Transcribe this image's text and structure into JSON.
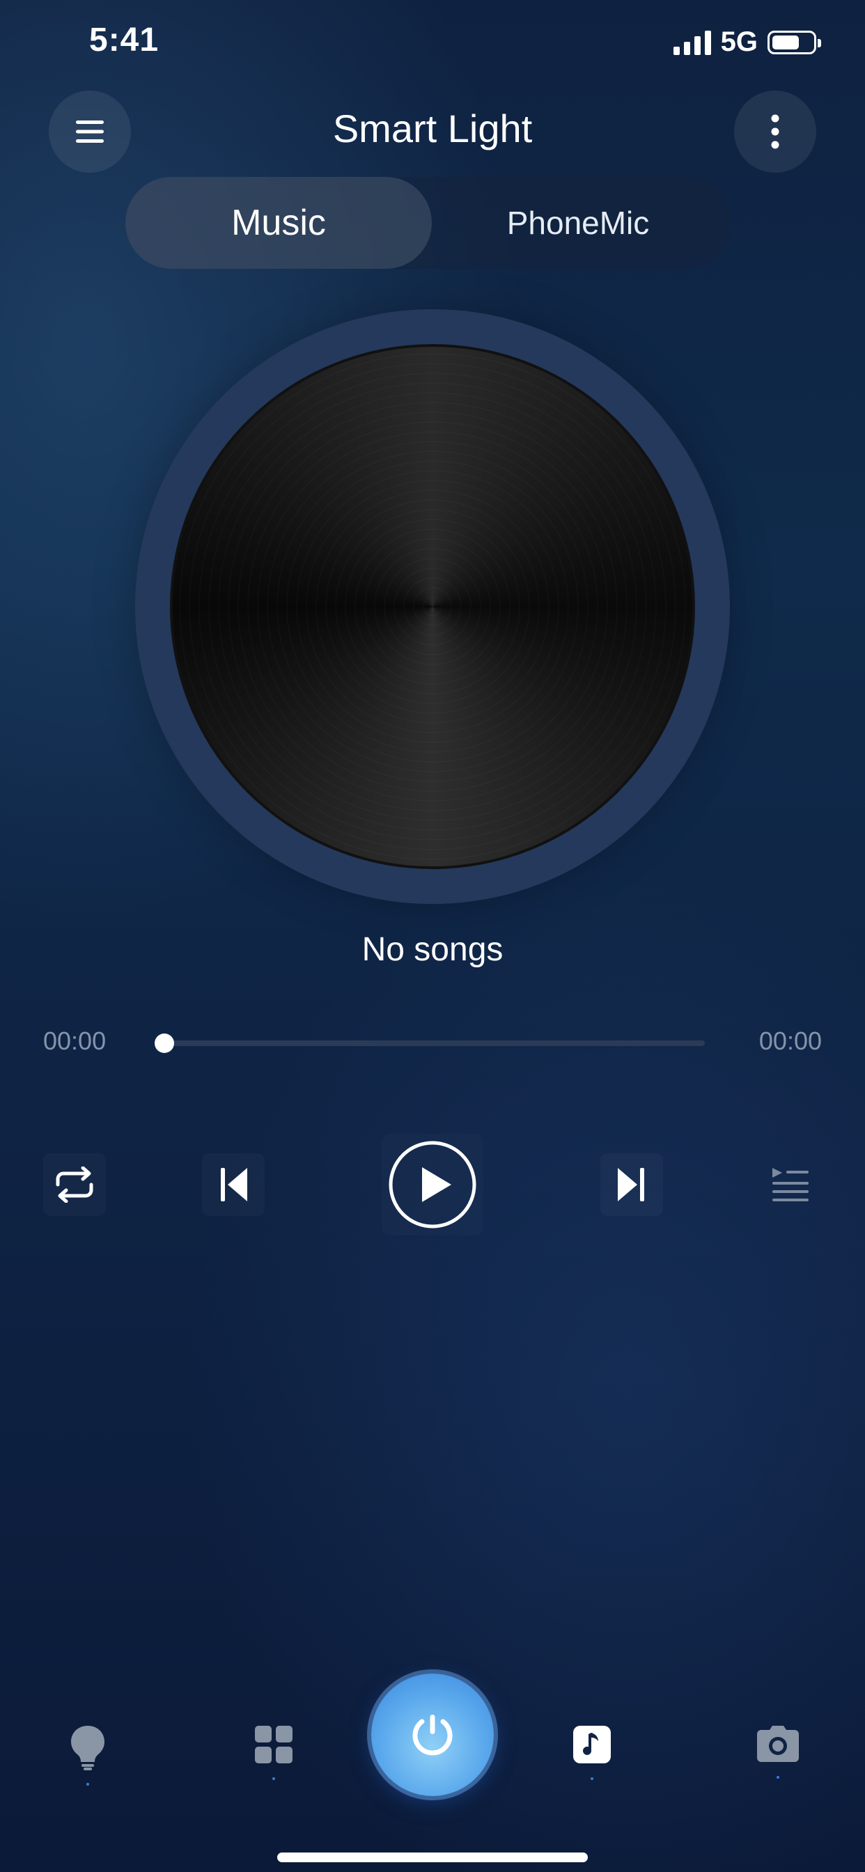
{
  "status_bar": {
    "time": "5:41",
    "network": "5G"
  },
  "header": {
    "title": "Smart Light",
    "menu_icon": "hamburger-menu-icon",
    "more_icon": "vertical-dots-icon"
  },
  "tabs": [
    {
      "label": "Music",
      "active": true
    },
    {
      "label": "PhoneMic",
      "active": false
    }
  ],
  "player": {
    "song_title": "No songs",
    "current_time": "00:00",
    "total_time": "00:00",
    "progress": 0,
    "controls": [
      "repeat-icon",
      "previous-track-icon",
      "play-icon",
      "next-track-icon",
      "playlist-icon"
    ]
  },
  "bottom_nav": {
    "items": [
      "bulb-icon",
      "scenes-grid-icon",
      "power-icon",
      "music-note-icon",
      "camera-icon"
    ],
    "active": "music-note-icon"
  },
  "colors": {
    "accent": "#5aa8ec",
    "ring": "#25395c",
    "track": "#2b3b57"
  }
}
